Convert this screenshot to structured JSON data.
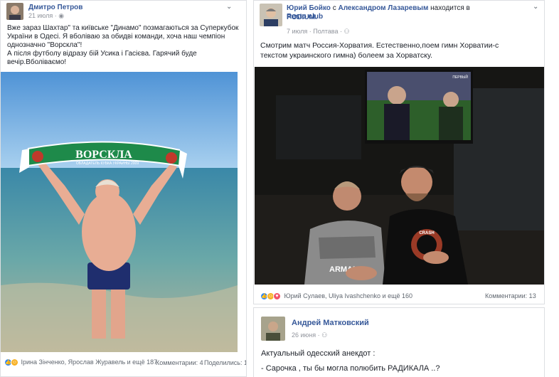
{
  "left_post": {
    "author": "Дмитро Петров",
    "date": "21 июля",
    "text_lines": [
      "Вже зараз Шахтар\" та київське \"Динамо\" позмагаються за Суперкубок",
      "України в Одесі. Я вболіваю за обидві команди, хоча наш чемпіон",
      "однозначно \"Ворскла\"!",
      "А після футболу відразу бій Усика і Гасієва. Гарячий буде",
      "вечір.Вболіваємо!"
    ],
    "scarf_text": "ВОРСКЛА",
    "scarf_subtext": "ОБЛАДАТЕЛЬ КУБКА УКРАИНЫ 2009",
    "reactions_text": "Ірина Зінченко, Ярослав Журавель и ещё 187",
    "comments_text": "Комментарии: 4",
    "shares_text": "Поделились: 1"
  },
  "right_post": {
    "author": "Юрий Бойко",
    "with_prefix": "с",
    "tagged": "Александром Лазаревым",
    "location_prefix": "находится в",
    "location": "Resto club",
    "location_line2": "PODIUM.",
    "date": "7 июля",
    "place": "Полтава",
    "text_line1": "Смотрим матч Россия-Хорватия. Естественно,поем гимн Хорватии-с",
    "text_line2": "текстом украинского гимна) болеем за Хорватску.",
    "tv_logo": "ПЕРВЫЙ",
    "shirt_text_1": "ARMANI",
    "shirt_text_2": "CRASH",
    "reactions_text": "Юрий Сулаев, Uliya Ivashchenko и ещё 160",
    "comments_text": "Комментарии: 13"
  },
  "second_post": {
    "author": "Андрей Матковский",
    "date": "26 июня",
    "line1": "Актуальный одесский анекдот :",
    "line2": "- Сарочка , ты бы могла полюбить РАДИКАЛА ..?"
  },
  "colors": {
    "link": "#365899",
    "meta": "#90949c",
    "like": "#2e89ff",
    "love": "#f25268",
    "haha": "#f7b125",
    "scarf_green": "#1e8a4a"
  }
}
